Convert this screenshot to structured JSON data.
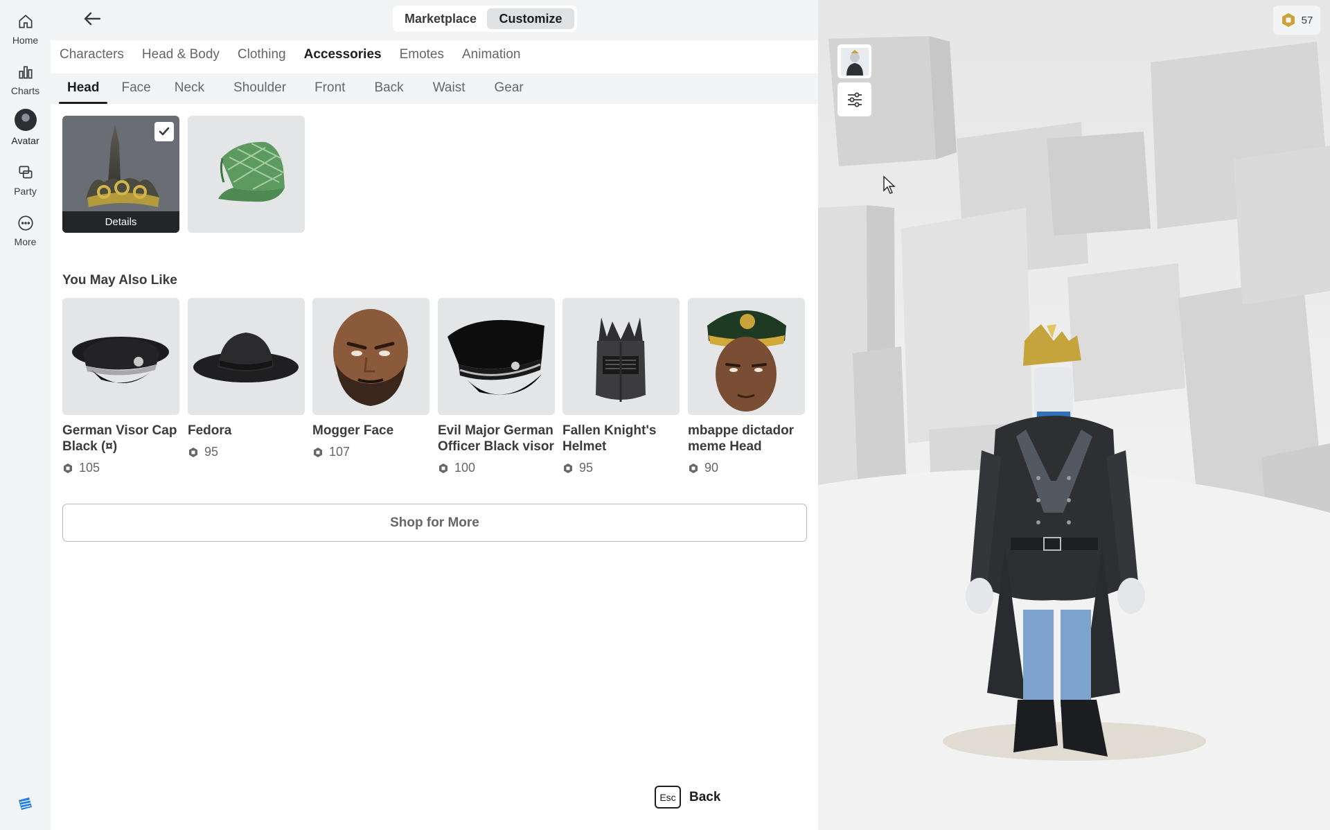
{
  "nav_rail": {
    "items": [
      {
        "label": "Home",
        "icon": "home-icon"
      },
      {
        "label": "Charts",
        "icon": "charts-icon"
      },
      {
        "label": "Avatar",
        "icon": "avatar-icon"
      },
      {
        "label": "Party",
        "icon": "party-icon"
      },
      {
        "label": "More",
        "icon": "more-icon"
      }
    ],
    "active": "Avatar"
  },
  "topbar": {
    "mode_tabs": [
      "Marketplace",
      "Customize"
    ],
    "active_mode": "Customize"
  },
  "category_tabs": [
    "Characters",
    "Head & Body",
    "Clothing",
    "Accessories",
    "Emotes",
    "Animation"
  ],
  "active_category": "Accessories",
  "subcategory_tabs": [
    "Head",
    "Face",
    "Neck",
    "Shoulder",
    "Front",
    "Back",
    "Waist",
    "Gear"
  ],
  "active_subcategory": "Head",
  "owned_items": [
    {
      "name": "Gold Crown",
      "equipped": true,
      "details_label": "Details"
    },
    {
      "name": "Green Plaid Cap",
      "equipped": false
    }
  ],
  "recommendations": {
    "title": "You May Also Like",
    "items": [
      {
        "name": "German Visor Cap Black (¤)",
        "price": "105"
      },
      {
        "name": "Fedora",
        "price": "95"
      },
      {
        "name": "Mogger Face",
        "price": "107"
      },
      {
        "name": "Evil Major German Officer Black visor",
        "price": "100"
      },
      {
        "name": "Fallen Knight's Helmet",
        "price": "95"
      },
      {
        "name": "mbappe dictador meme Head",
        "price": "90"
      }
    ]
  },
  "shop_button": "Shop for More",
  "esc_hint": {
    "key": "Esc",
    "label": "Back"
  },
  "robux_balance": "57",
  "colors": {
    "rail_bg": "#f2f4f5",
    "text_primary": "#1b1d1f",
    "text_secondary": "#656668",
    "tile_bg": "#e3e5e7",
    "scene_bg": "#e9e9e9"
  }
}
